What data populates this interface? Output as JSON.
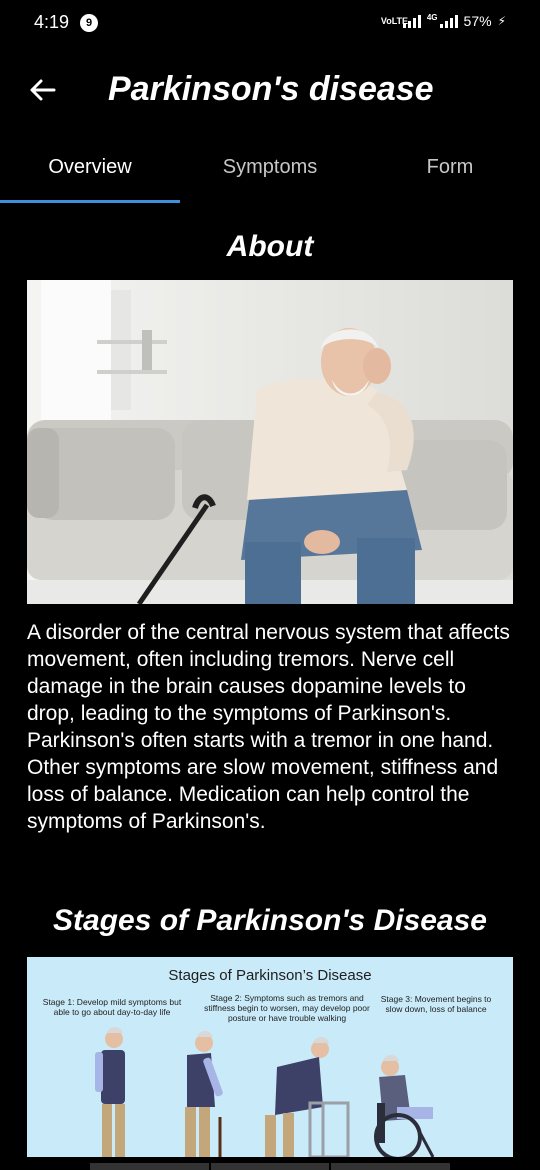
{
  "status_bar": {
    "time": "4:19",
    "notification_count": "9",
    "volte": "VoLTE",
    "network": "4G",
    "battery": "57%"
  },
  "app_bar": {
    "title": "Parkinson's disease",
    "back_icon": "arrow-left-icon"
  },
  "tabs": [
    {
      "label": "Overview",
      "active": true
    },
    {
      "label": "Symptoms",
      "active": false
    },
    {
      "label": "Form",
      "active": false
    }
  ],
  "about": {
    "title": "About",
    "image_alt": "Elderly man with a cane sitting on a sofa, holding his head",
    "description": "A disorder of the central nervous system that affects movement, often including tremors. Nerve cell damage in the brain causes dopamine levels to drop, leading to the symptoms of Parkinson's. Parkinson's often starts with a tremor in one hand. Other symptoms are slow movement, stiffness and loss of balance. Medication can help control the symptoms of Parkinson's."
  },
  "stages": {
    "title": "Stages of Parkinson's Disease",
    "infographic": {
      "title": "Stages of Parkinson’s Disease",
      "stage_1": "Stage 1: Develop mild symptoms but able to go about day-to-day life",
      "stage_2": "Stage 2: Symptoms such as tremors and stiffness begin to worsen, may develop poor posture or have trouble walking",
      "stage_3": "Stage 3: Movement begins to slow down, loss of balance"
    }
  },
  "colors": {
    "background": "#000000",
    "tab_indicator": "#3f8fdf",
    "infographic_bg": "#c9eaf8"
  }
}
